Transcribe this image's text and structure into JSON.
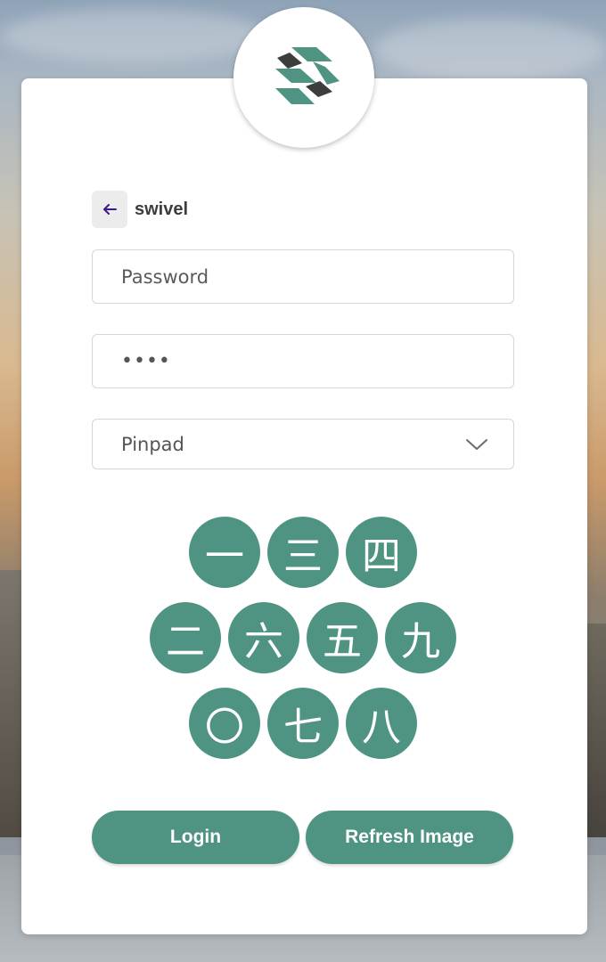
{
  "brand": {
    "accent_color": "#4f9482",
    "logo_icon": "swivel-logo-icon"
  },
  "user": {
    "back_icon": "arrow-left-icon",
    "username": "swivel"
  },
  "fields": {
    "username_placeholder": "Password",
    "password_value": "••••",
    "auth_method": "Pinpad",
    "dropdown_icon": "chevron-down-icon"
  },
  "pinpad": {
    "rows": [
      [
        "一",
        "三",
        "四"
      ],
      [
        "二",
        "六",
        "五",
        "九"
      ],
      [
        "〇",
        "七",
        "八"
      ]
    ]
  },
  "actions": {
    "login_label": "Login",
    "refresh_label": "Refresh Image"
  }
}
